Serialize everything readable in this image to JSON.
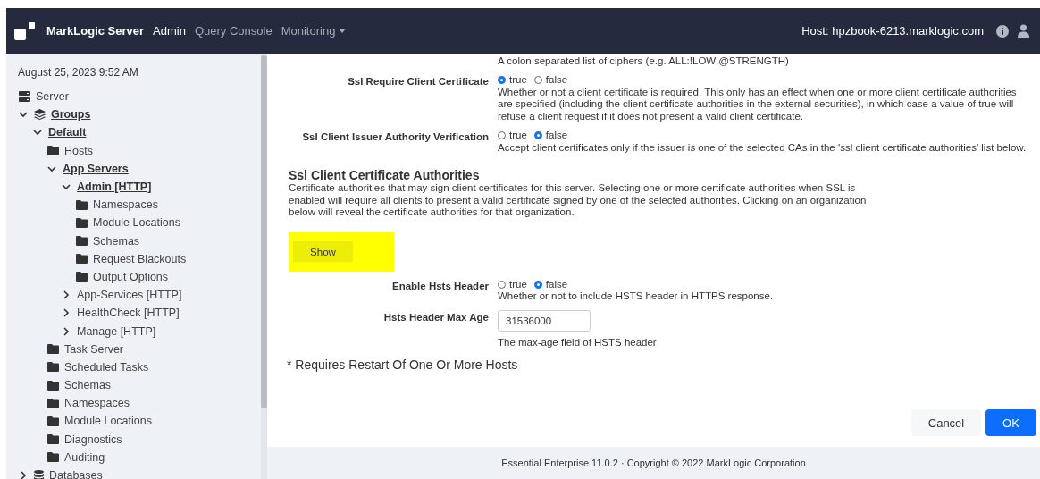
{
  "navbar": {
    "brand": "MarkLogic Server",
    "links": [
      {
        "label": "Admin",
        "selected": true,
        "dropdown": false
      },
      {
        "label": "Query Console",
        "selected": false,
        "dropdown": false
      },
      {
        "label": "Monitoring",
        "selected": false,
        "dropdown": true
      }
    ],
    "host": "Host: hpzbook-6213.marklogic.com"
  },
  "sidebar": {
    "date": "August 25, 2023 9:52 AM",
    "tree": [
      {
        "label": "Server",
        "kind": "server",
        "selected": false
      },
      {
        "label": "Groups",
        "kind": "group",
        "selected": true,
        "expanded": true,
        "children": [
          {
            "label": "Default",
            "kind": "node",
            "selected": true,
            "expanded": true,
            "children": [
              {
                "label": "Hosts",
                "kind": "folder",
                "selected": false
              },
              {
                "label": "App Servers",
                "kind": "node",
                "selected": true,
                "expanded": true,
                "children": [
                  {
                    "label": "Admin [HTTP]",
                    "kind": "node",
                    "selected": true,
                    "expanded": true,
                    "children": [
                      {
                        "label": "Namespaces",
                        "kind": "folder",
                        "selected": false
                      },
                      {
                        "label": "Module Locations",
                        "kind": "folder",
                        "selected": false
                      },
                      {
                        "label": "Schemas",
                        "kind": "folder",
                        "selected": false
                      },
                      {
                        "label": "Request Blackouts",
                        "kind": "folder",
                        "selected": false
                      },
                      {
                        "label": "Output Options",
                        "kind": "folder",
                        "selected": false
                      }
                    ]
                  },
                  {
                    "label": "App-Services [HTTP]",
                    "kind": "node",
                    "selected": false,
                    "expanded": false
                  },
                  {
                    "label": "HealthCheck [HTTP]",
                    "kind": "node",
                    "selected": false,
                    "expanded": false
                  },
                  {
                    "label": "Manage [HTTP]",
                    "kind": "node",
                    "selected": false,
                    "expanded": false
                  }
                ]
              },
              {
                "label": "Task Server",
                "kind": "folder",
                "selected": false
              },
              {
                "label": "Scheduled Tasks",
                "kind": "folder",
                "selected": false
              },
              {
                "label": "Schemas",
                "kind": "folder",
                "selected": false
              },
              {
                "label": "Namespaces",
                "kind": "folder",
                "selected": false
              },
              {
                "label": "Module Locations",
                "kind": "folder",
                "selected": false
              },
              {
                "label": "Diagnostics",
                "kind": "folder",
                "selected": false
              },
              {
                "label": "Auditing",
                "kind": "folder",
                "selected": false
              }
            ]
          }
        ]
      },
      {
        "label": "Databases",
        "kind": "database",
        "selected": false,
        "expanded": false
      }
    ]
  },
  "form": {
    "cut_description": "A colon separated list of ciphers (e.g. ALL:!LOW:@STRENGTH)",
    "settings": [
      {
        "label": "Ssl Require Client Certificate",
        "kind": "radio",
        "options": [
          {
            "label": "true",
            "selected": true
          },
          {
            "label": "false",
            "selected": false
          }
        ],
        "description": "Whether or not a client certificate is required. This only has an effect when one or more client certificate authorities are specified (including the client certificate authorities in the external securities), in which case a value of true will refuse a client request if it does not present a valid client certificate."
      },
      {
        "label": "Ssl Client Issuer Authority Verification",
        "kind": "radio",
        "options": [
          {
            "label": "true",
            "selected": false
          },
          {
            "label": "false",
            "selected": true
          }
        ],
        "description": "Accept client certificates only if the issuer is one of the selected CAs in the 'ssl client certificate authorities' list below."
      }
    ],
    "section": {
      "title": "Ssl Client Certificate Authorities",
      "description": "Certificate authorities that may sign client certificates for this server. Selecting one or more certificate authorities when SSL is enabled will require all clients to present a valid certificate signed by one of the selected authorities. Clicking on an organization below will reveal the certificate authorities for that organization.",
      "button": "Show",
      "highlighted": true
    },
    "settings_2": [
      {
        "label": "Enable Hsts Header",
        "kind": "radio",
        "options": [
          {
            "label": "true",
            "selected": false
          },
          {
            "label": "false",
            "selected": true
          }
        ],
        "description": "Whether or not to include HSTS header in HTTPS response."
      },
      {
        "label": "Hsts Header Max Age",
        "kind": "number",
        "value": "31536000",
        "description": "The max-age field of HSTS header"
      }
    ],
    "footnote": "* Requires Restart Of One Or More Hosts",
    "buttons": [
      {
        "label": "Cancel",
        "kind": "secondary"
      },
      {
        "label": "OK",
        "kind": "primary"
      }
    ]
  },
  "footer": "Essential Enterprise 11.0.2 · Copyright © 2022 MarkLogic Corporation"
}
